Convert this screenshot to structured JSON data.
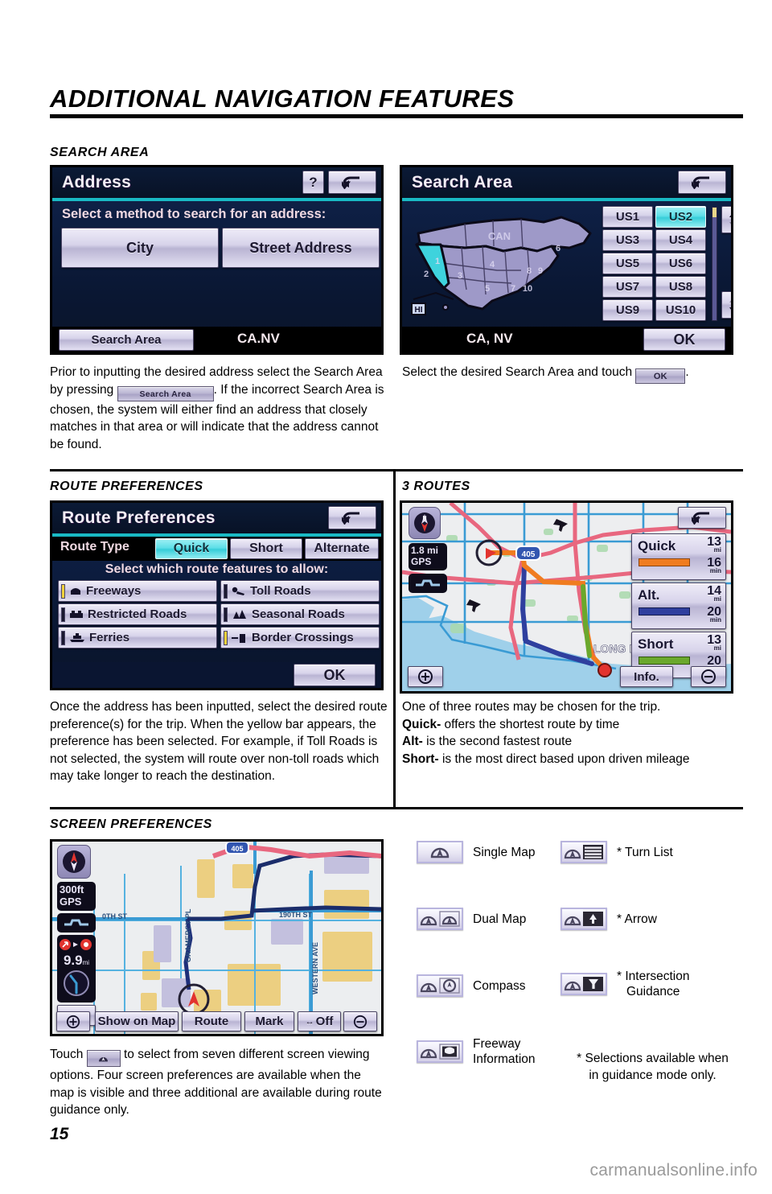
{
  "header": {
    "title": "ADDITIONAL NAVIGATION FEATURES"
  },
  "sections": {
    "search_area": {
      "heading": "SEARCH AREA",
      "left_screen": {
        "title": "Address",
        "help_button": "?",
        "back_button": "back-arrow",
        "prompt": "Select a method to search for an address:",
        "buttons": [
          "City",
          "Street Address"
        ],
        "footer_button": "Search Area",
        "footer_value": "CA.NV"
      },
      "right_screen": {
        "title": "Search Area",
        "back_button": "back-arrow",
        "map_labels": [
          "CAN",
          "HI"
        ],
        "region_buttons": [
          "US1",
          "US2",
          "US3",
          "US4",
          "US5",
          "US6",
          "US7",
          "US8",
          "US9",
          "US10"
        ],
        "selected_region": "US2",
        "scroll_up": "scroll-up",
        "scroll_down": "scroll-down",
        "footer_value": "CA, NV",
        "ok_button": "OK"
      },
      "left_text_parts": {
        "a": "Prior to inputting the desired address select the Search Area by pressing ",
        "chip": "Search Area",
        "b": ". If the incorrect Search Area is chosen, the system will either find an address that closely matches in that area or will indicate that the address cannot be found."
      },
      "right_text_parts": {
        "a": "Select the desired Search Area and touch ",
        "chip": "OK",
        "b": "."
      }
    },
    "route_preferences": {
      "heading": "ROUTE PREFERENCES",
      "screen": {
        "title": "Route Preferences",
        "back_button": "back-arrow",
        "route_type_label": "Route Type",
        "route_types": [
          "Quick",
          "Short",
          "Alternate"
        ],
        "selected_route_type": "Quick",
        "prompt": "Select which route features to allow:",
        "features": [
          {
            "label": "Freeways",
            "selected": true,
            "icon": "freeway-icon"
          },
          {
            "label": "Toll Roads",
            "selected": false,
            "icon": "toll-icon"
          },
          {
            "label": "Restricted Roads",
            "selected": false,
            "icon": "restricted-icon"
          },
          {
            "label": "Seasonal Roads",
            "selected": false,
            "icon": "seasonal-icon"
          },
          {
            "label": "Ferries",
            "selected": false,
            "icon": "ferry-icon"
          },
          {
            "label": "Border Crossings",
            "selected": true,
            "icon": "border-icon"
          }
        ],
        "ok_button": "OK"
      },
      "text": "Once the address has been inputted, select the desired route preference(s) for the trip. When the yellow bar appears, the preference has been selected. For example, if Toll Roads is not selected, the system will route over non-toll roads which may take longer to reach the destination."
    },
    "three_routes": {
      "heading": "3 ROUTES",
      "screen": {
        "back_button": "back-arrow",
        "compass": "N",
        "scale": "1.8 mi",
        "gps": "GPS",
        "map_label": "LONG BEA",
        "highway_shield": "405",
        "routes": [
          {
            "name": "Quick",
            "distance": "13",
            "distance_unit": "mi",
            "time": "16",
            "time_unit": "min",
            "color": "#f07c20"
          },
          {
            "name": "Alt.",
            "distance": "14",
            "distance_unit": "mi",
            "time": "20",
            "time_unit": "min",
            "color": "#2f3f9e"
          },
          {
            "name": "Short",
            "distance": "13",
            "distance_unit": "mi",
            "time": "20",
            "time_unit": "min",
            "color": "#6aa82c"
          }
        ],
        "zoom_in": "+",
        "zoom_out": "−",
        "info_button": "Info."
      },
      "text_lines": [
        {
          "bold": "",
          "rest": "One of three routes may be chosen for the trip."
        },
        {
          "bold": "Quick-",
          "rest": " offers the shortest route by time"
        },
        {
          "bold": "Alt-",
          "rest": " is the second fastest route"
        },
        {
          "bold": "Short-",
          "rest": " is the most direct based upon driven mileage"
        }
      ]
    },
    "screen_preferences": {
      "heading": "SCREEN PREFERENCES",
      "map_screen": {
        "compass": "compass-icon",
        "scale": "300ft",
        "gps": "GPS",
        "eta_value": "9.9",
        "eta_unit": "mi",
        "street_labels": [
          "0TH ST",
          "190TH ST",
          "GRAMERCY PL",
          "WESTERN AVE"
        ],
        "shield": "405",
        "footer_buttons": [
          "Show on Map",
          "Route",
          "Mark",
          "Off"
        ],
        "zoom_in": "+",
        "zoom_out": "−"
      },
      "options": [
        {
          "label": "Single Map",
          "icon": "single-map-icon",
          "starred": false
        },
        {
          "label": "* Turn List",
          "icon": "turn-list-icon",
          "starred": true
        },
        {
          "label": "Dual Map",
          "icon": "dual-map-icon",
          "starred": false
        },
        {
          "label": "* Arrow",
          "icon": "arrow-icon",
          "starred": true
        },
        {
          "label": "Compass",
          "icon": "compass-view-icon",
          "starred": false
        },
        {
          "label": "* Intersection\nGuidance",
          "icon": "intersection-guidance-icon",
          "starred": true
        },
        {
          "label": "Freeway\nInformation",
          "icon": "freeway-info-icon",
          "starred": false
        }
      ],
      "options_text": {
        "single_map": "Single Map",
        "turn_list": "* Turn List",
        "dual_map": "Dual Map",
        "arrow": "* Arrow",
        "compass": "Compass",
        "intersection_line1": "* Intersection",
        "intersection_line2": "Guidance",
        "freeway_line1": "Freeway",
        "freeway_line2": "Information"
      },
      "footnote_line1": "* Selections available when",
      "footnote_line2": "in guidance mode only.",
      "text_parts": {
        "a": "Touch ",
        "chip": "screen-pref-icon",
        "b": " to select from seven different screen viewing options. Four screen preferences are available when the map is visible and three additional are available during route guidance only."
      }
    }
  },
  "footer": {
    "page_number": "15",
    "watermark": "carmanualsonline.info"
  },
  "colors": {
    "teal_accent": "#19b9c4",
    "quick_route": "#f07c20",
    "alt_route": "#2f3f9e",
    "short_route": "#6aa82c",
    "watermark_gray": "#9a9a9a"
  }
}
